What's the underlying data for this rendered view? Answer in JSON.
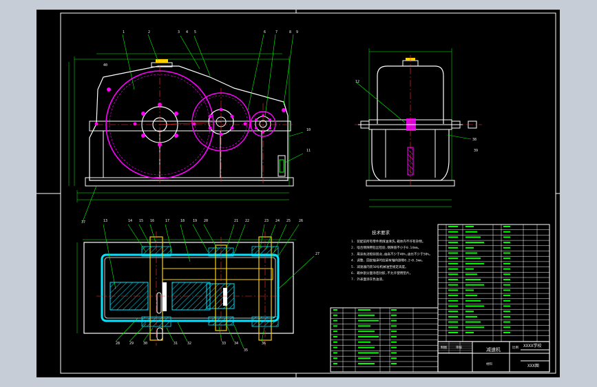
{
  "drawing": {
    "title_block": {
      "product_name": "减速机",
      "school": "XXXX学校",
      "drawing_no": "XXX图",
      "scale_label": "比例",
      "material_label": "材料",
      "drawer_label": "制图",
      "checker_label": "审核"
    },
    "notes": {
      "heading": "技术要求",
      "lines": [
        "1. 装配前所有零件用煤油清洗,箱体内不许有杂物。",
        "2. 啮合侧隙用铅丝检验,侧隙值不小于0.14mm。",
        "3. 用涂色法检验斑点,齿高不少于40%,齿长不少于50%。",
        "4. 调整、固定轴承时应留有轴向游隙0.2~0.3mm。",
        "5. 减速器内装50号机械油至规定高度。",
        "6. 箱体剖分面涂密封胶,不允许使用垫片。",
        "7. 外表面涂灰色油漆。"
      ]
    },
    "part_callouts": [
      "1",
      "2",
      "3",
      "4",
      "5",
      "6",
      "7",
      "8",
      "9",
      "10",
      "11",
      "12",
      "13",
      "14",
      "15",
      "16",
      "17",
      "18",
      "19",
      "20",
      "21",
      "22",
      "23",
      "24",
      "25",
      "26",
      "27",
      "28",
      "29",
      "30",
      "31",
      "32",
      "33",
      "34",
      "35",
      "36",
      "37",
      "38",
      "39",
      "40"
    ],
    "colors": {
      "background": "#000000",
      "frame": "#ffffff",
      "outline": "#ffffff",
      "gear": "#ff00ff",
      "dimension": "#00ff00",
      "center_line": "#ff3030",
      "shaft": "#ffd200",
      "section": "#00e5ff"
    }
  }
}
